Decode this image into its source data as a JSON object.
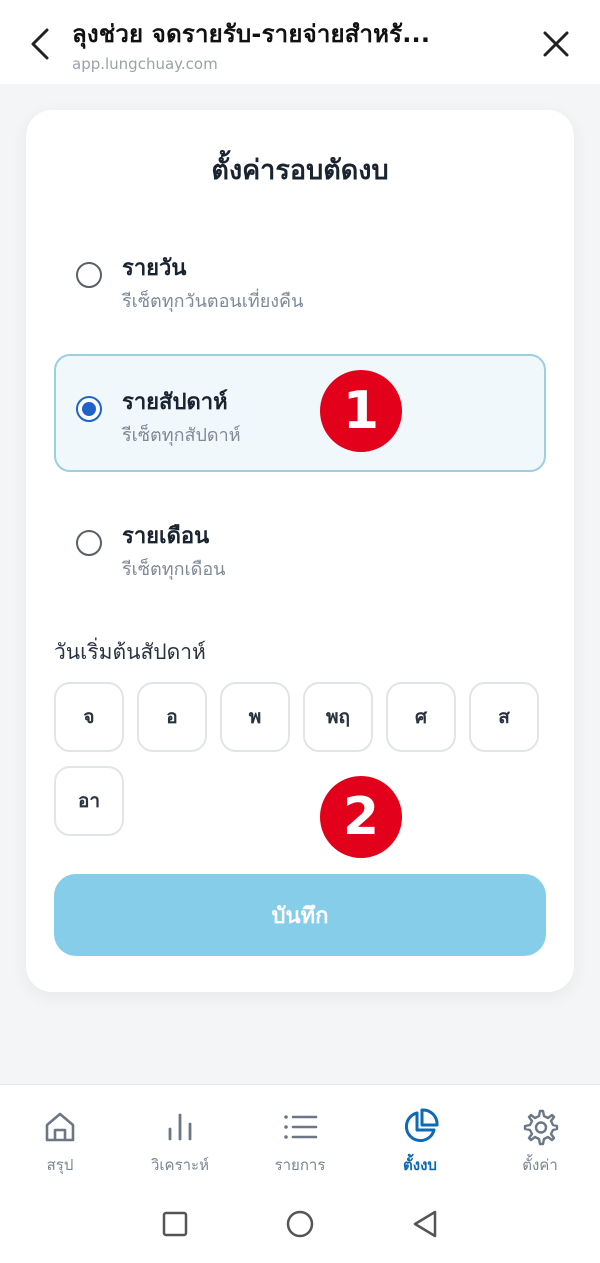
{
  "browser": {
    "title": "ลุงช่วย จดรายรับ-รายจ่ายสำหรั...",
    "url": "app.lungchuay.com"
  },
  "card": {
    "title": "ตั้งค่ารอบตัดงบ",
    "options": [
      {
        "label": "รายวัน",
        "desc": "รีเซ็ตทุกวันตอนเที่ยงคืน",
        "selected": false
      },
      {
        "label": "รายสัปดาห์",
        "desc": "รีเซ็ตทุกสัปดาห์",
        "selected": true
      },
      {
        "label": "รายเดือน",
        "desc": "รีเซ็ตทุกเดือน",
        "selected": false
      }
    ],
    "week_start_label": "วันเริ่มต้นสัปดาห์",
    "days": [
      "จ",
      "อ",
      "พ",
      "พฤ",
      "ศ",
      "ส",
      "อา"
    ],
    "save_label": "บันทึก"
  },
  "badges": [
    "1",
    "2"
  ],
  "bottom_nav": [
    {
      "label": "สรุป",
      "icon": "home-icon",
      "active": false
    },
    {
      "label": "วิเคราะห์",
      "icon": "bar-chart-icon",
      "active": false
    },
    {
      "label": "รายการ",
      "icon": "list-icon",
      "active": false
    },
    {
      "label": "ตั้งงบ",
      "icon": "pie-chart-icon",
      "active": true
    },
    {
      "label": "ตั้งค่า",
      "icon": "gear-icon",
      "active": false
    }
  ],
  "colors": {
    "accent": "#1f63c9",
    "save_button": "#86cde9",
    "active_nav": "#0f6ab4",
    "badge": "#e3001b"
  }
}
